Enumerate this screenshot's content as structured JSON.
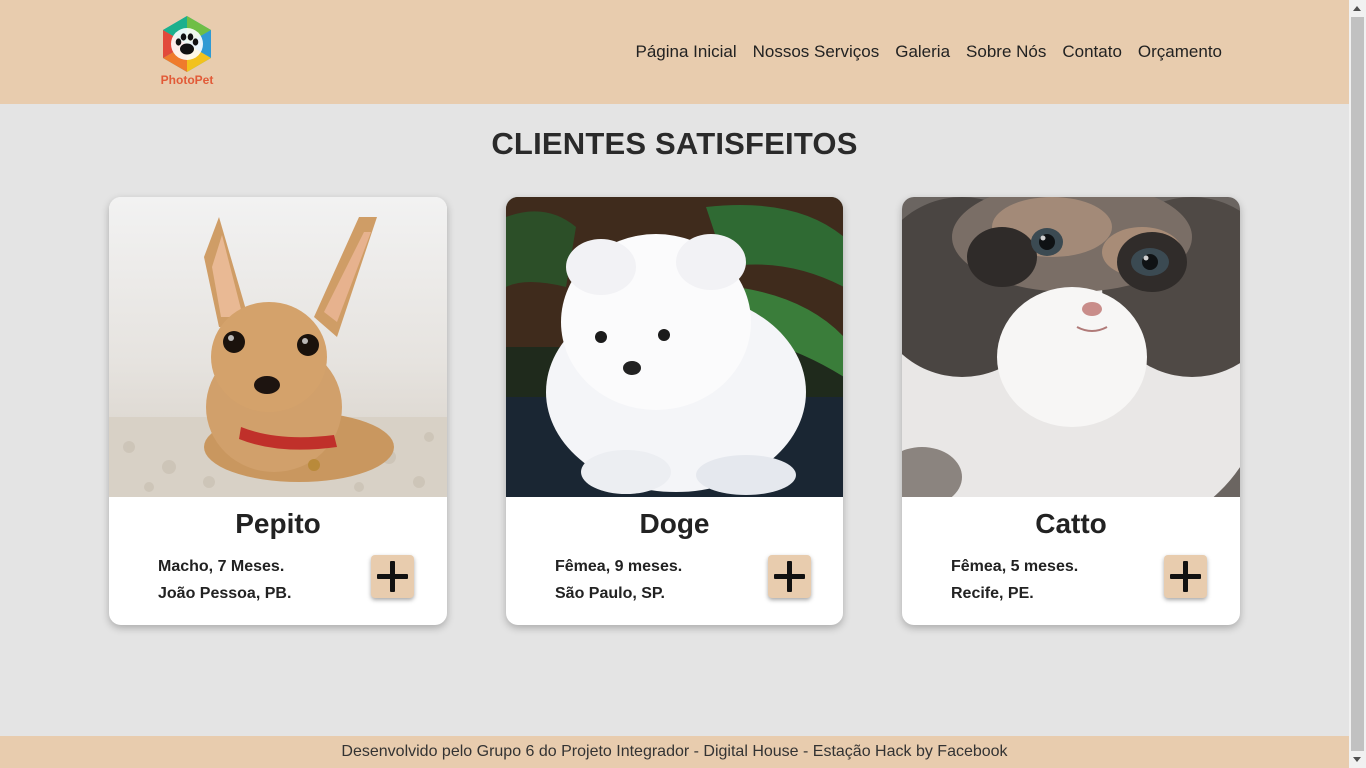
{
  "brand": {
    "name": "PhotoPet",
    "accent": "#e8ccae",
    "logo_text_color": "#e25a37"
  },
  "nav": {
    "items": [
      {
        "label": "Página Inicial"
      },
      {
        "label": "Nossos Serviços"
      },
      {
        "label": "Galeria"
      },
      {
        "label": "Sobre Nós"
      },
      {
        "label": "Contato"
      },
      {
        "label": "Orçamento"
      }
    ]
  },
  "main": {
    "title": "CLIENTES SATISFEITOS",
    "cards": [
      {
        "name": "Pepito",
        "line1": "Macho, 7 Meses.",
        "line2": "João Pessoa, PB.",
        "photo": "chihuahua-photo"
      },
      {
        "name": "Doge",
        "line1": "Fêmea, 9 meses.",
        "line2": "São Paulo, SP.",
        "photo": "pomeranian-photo"
      },
      {
        "name": "Catto",
        "line1": "Fêmea, 5 meses.",
        "line2": "Recife, PE.",
        "photo": "kitten-photo"
      }
    ]
  },
  "footer": {
    "text": "Desenvolvido pelo Grupo 6 do Projeto Integrador - Digital House - Estação Hack by Facebook"
  }
}
